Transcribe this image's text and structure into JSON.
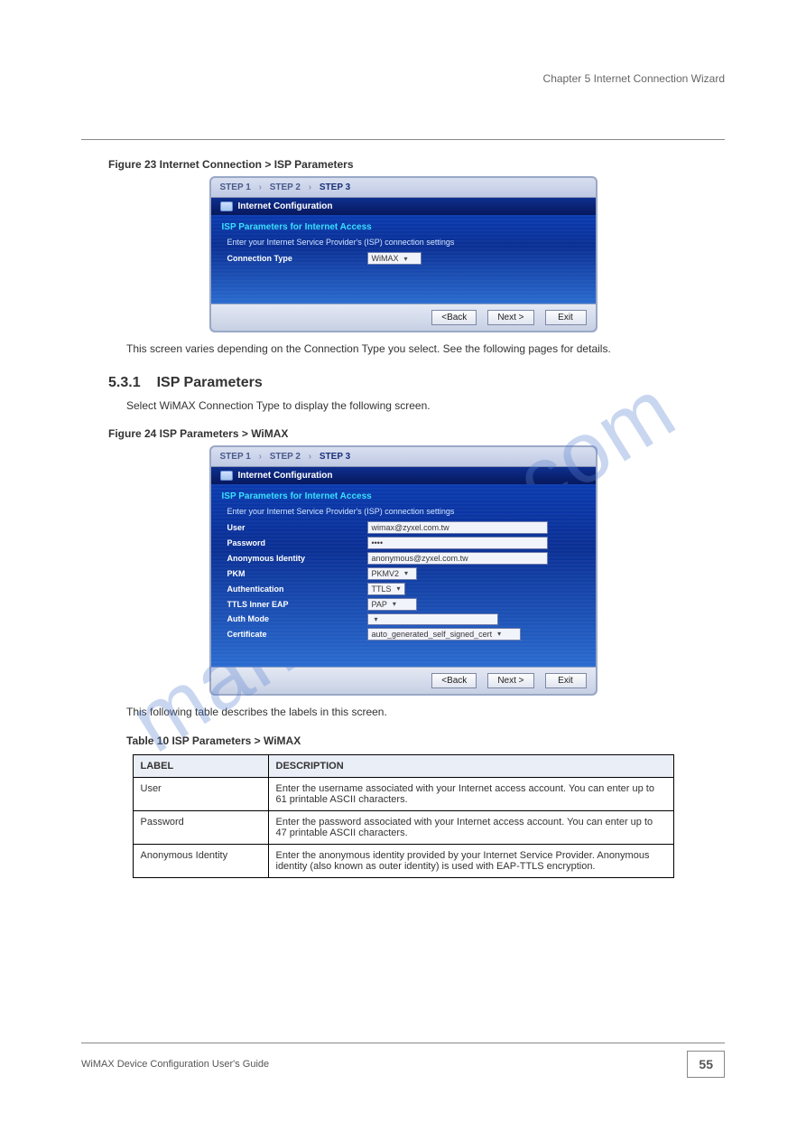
{
  "header": {
    "chapter": "Chapter 5 Internet Connection Wizard"
  },
  "watermark": "manualslib.com",
  "figure1": {
    "label": "Figure 23   Internet Connection > ISP Parameters",
    "steps": {
      "s1": "STEP 1",
      "s2": "STEP 2",
      "s3": "STEP 3"
    },
    "title": "Internet Configuration",
    "section": "ISP Parameters for Internet Access",
    "subtext": "Enter your Internet Service Provider's (ISP) connection settings",
    "conn_type_label": "Connection Type",
    "conn_type_value": "WiMAX",
    "back": "<Back",
    "next": "Next >",
    "exit": "Exit"
  },
  "mid_text": "This screen varies depending on the Connection Type you select. See the following pages for details.",
  "subsection": {
    "num": "5.3.1",
    "title": "ISP Parameters"
  },
  "subsection_text": "Select WiMAX Connection Type to display the following screen.",
  "figure2": {
    "label": "Figure 24   ISP Parameters > WiMAX",
    "steps": {
      "s1": "STEP 1",
      "s2": "STEP 2",
      "s3": "STEP 3"
    },
    "title": "Internet Configuration",
    "section": "ISP Parameters for Internet Access",
    "subtext": "Enter your Internet Service Provider's (ISP) connection settings",
    "fields": {
      "user_label": "User",
      "user_value": "wimax@zyxel.com.tw",
      "password_label": "Password",
      "password_value": "••••",
      "anon_label": "Anonymous Identity",
      "anon_value": "anonymous@zyxel.com.tw",
      "pkm_label": "PKM",
      "pkm_value": "PKMV2",
      "auth_label": "Authentication",
      "auth_value": "TTLS",
      "ttls_label": "TTLS Inner EAP",
      "ttls_value": "PAP",
      "authmode_label": "Auth Mode",
      "authmode_value": "",
      "cert_label": "Certificate",
      "cert_value": "auto_generated_self_signed_cert"
    },
    "back": "<Back",
    "next": "Next >",
    "exit": "Exit"
  },
  "table_intro": "This following table describes the labels in this screen.",
  "table": {
    "caption": "Table 10   ISP Parameters > WiMAX",
    "head_label": "LABEL",
    "head_desc": "DESCRIPTION",
    "rows": [
      {
        "label": "User",
        "desc": "Enter the username associated with your Internet access account. You can enter up to 61 printable ASCII characters."
      },
      {
        "label": "Password",
        "desc": "Enter the password associated with your Internet access account. You can enter up to 47 printable ASCII characters."
      },
      {
        "label": "Anonymous Identity",
        "desc": "Enter the anonymous identity provided by your Internet Service Provider. Anonymous identity (also known as outer identity) is used with EAP-TTLS encryption."
      }
    ]
  },
  "footer": {
    "guide": "WiMAX Device Configuration User's Guide",
    "page": "55"
  }
}
